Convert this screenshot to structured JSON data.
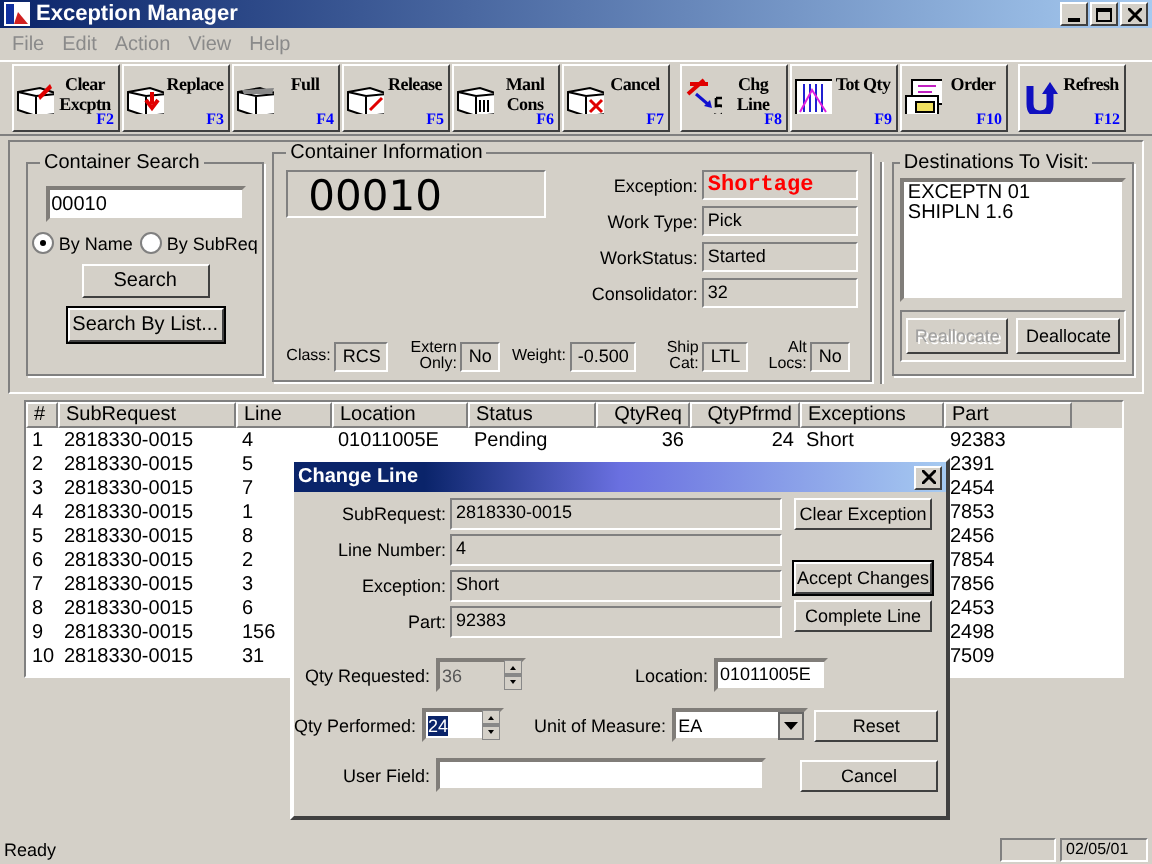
{
  "window": {
    "title": "Exception Manager"
  },
  "menu": [
    {
      "label": "File",
      "disabled": true
    },
    {
      "label": "Edit",
      "disabled": true
    },
    {
      "label": "Action",
      "disabled": true
    },
    {
      "label": "View",
      "disabled": true
    },
    {
      "label": "Help",
      "disabled": true
    }
  ],
  "toolbar": [
    {
      "label": "Clear Excptn",
      "key": "F2"
    },
    {
      "label": "Replace",
      "key": "F3"
    },
    {
      "label": "Full",
      "key": "F4"
    },
    {
      "label": "Release",
      "key": "F5"
    },
    {
      "label": "Manl Cons",
      "key": "F6"
    },
    {
      "label": "Cancel",
      "key": "F7"
    },
    {
      "label": "Chg Line",
      "key": "F8"
    },
    {
      "label": "Tot Qty",
      "key": "F9"
    },
    {
      "label": "Order",
      "key": "F10"
    },
    {
      "label": "Refresh",
      "key": "F12"
    }
  ],
  "container_search": {
    "title": "Container Search",
    "value": "00010",
    "options": [
      {
        "label": "By Name",
        "selected": true
      },
      {
        "label": "By SubReq",
        "selected": false
      }
    ],
    "buttons": [
      "Search",
      "Search By List..."
    ]
  },
  "container_info": {
    "title": "Container Information",
    "number": "00010",
    "fields": [
      {
        "label": "Exception:",
        "value": "Shortage",
        "alert": true
      },
      {
        "label": "Work Type:",
        "value": "Pick",
        "alert": false
      },
      {
        "label": "WorkStatus:",
        "value": "Started",
        "alert": false
      },
      {
        "label": "Consolidator:",
        "value": "32",
        "alert": false
      }
    ],
    "attributes": [
      {
        "label": "Class:",
        "value": "RCS"
      },
      {
        "label": "Extern Only:",
        "value": "No"
      },
      {
        "label": "Weight:",
        "value": "-0.500"
      },
      {
        "label": "Ship Cat:",
        "value": "LTL"
      },
      {
        "label": "Alt Locs:",
        "value": "No"
      }
    ]
  },
  "destinations": {
    "title": "Destinations To Visit:",
    "items": [
      "EXCEPTN 01",
      "SHIPLN 1.6"
    ],
    "buttons": [
      {
        "label": "Reallocate",
        "disabled": true
      },
      {
        "label": "Deallocate",
        "disabled": false
      }
    ]
  },
  "table": {
    "columns": [
      "#",
      "SubRequest",
      "Line",
      "Location",
      "Status",
      "QtyReq",
      "QtyPfrmd",
      "Exceptions",
      "Part"
    ],
    "rows": [
      [
        "1",
        "2818330-0015",
        "4",
        "01011005E",
        "Pending",
        "36",
        "24",
        "Short",
        "92383"
      ],
      [
        "2",
        "2818330-0015",
        "5",
        null,
        null,
        null,
        null,
        null,
        "2391"
      ],
      [
        "3",
        "2818330-0015",
        "7",
        null,
        null,
        null,
        null,
        null,
        "2454"
      ],
      [
        "4",
        "2818330-0015",
        "1",
        null,
        null,
        null,
        null,
        null,
        "7853"
      ],
      [
        "5",
        "2818330-0015",
        "8",
        null,
        null,
        null,
        null,
        null,
        "2456"
      ],
      [
        "6",
        "2818330-0015",
        "2",
        null,
        null,
        null,
        null,
        null,
        "7854"
      ],
      [
        "7",
        "2818330-0015",
        "3",
        null,
        null,
        null,
        null,
        null,
        "7856"
      ],
      [
        "8",
        "2818330-0015",
        "6",
        null,
        null,
        null,
        null,
        null,
        "2453"
      ],
      [
        "9",
        "2818330-0015",
        "156",
        null,
        null,
        null,
        null,
        null,
        "2498"
      ],
      [
        "10",
        "2818330-0015",
        "31",
        null,
        null,
        null,
        null,
        null,
        "7509"
      ]
    ]
  },
  "dialog": {
    "title": "Change Line",
    "fields": [
      {
        "label": "SubRequest:",
        "value": "2818330-0015"
      },
      {
        "label": "Line Number:",
        "value": "4"
      },
      {
        "label": "Exception:",
        "value": "Short"
      },
      {
        "label": "Part:",
        "value": "92383"
      }
    ],
    "qty_requested": {
      "label": "Qty Requested:",
      "value": "36",
      "disabled": true
    },
    "qty_performed": {
      "label": "Qty Performed:",
      "value": "24",
      "disabled": false
    },
    "location": {
      "label": "Location:",
      "value": "01011005E"
    },
    "unit": {
      "label": "Unit of Measure:",
      "value": "EA"
    },
    "user_field": {
      "label": "User Field:"
    },
    "buttons": [
      {
        "label": "Clear Exception",
        "default": false
      },
      {
        "label": "Accept Changes",
        "default": true
      },
      {
        "label": "Complete Line",
        "default": false
      },
      {
        "label": "Reset",
        "default": false
      },
      {
        "label": "Cancel",
        "default": false
      }
    ]
  },
  "status_bar": {
    "text": "Ready",
    "date": "02/05/01"
  }
}
